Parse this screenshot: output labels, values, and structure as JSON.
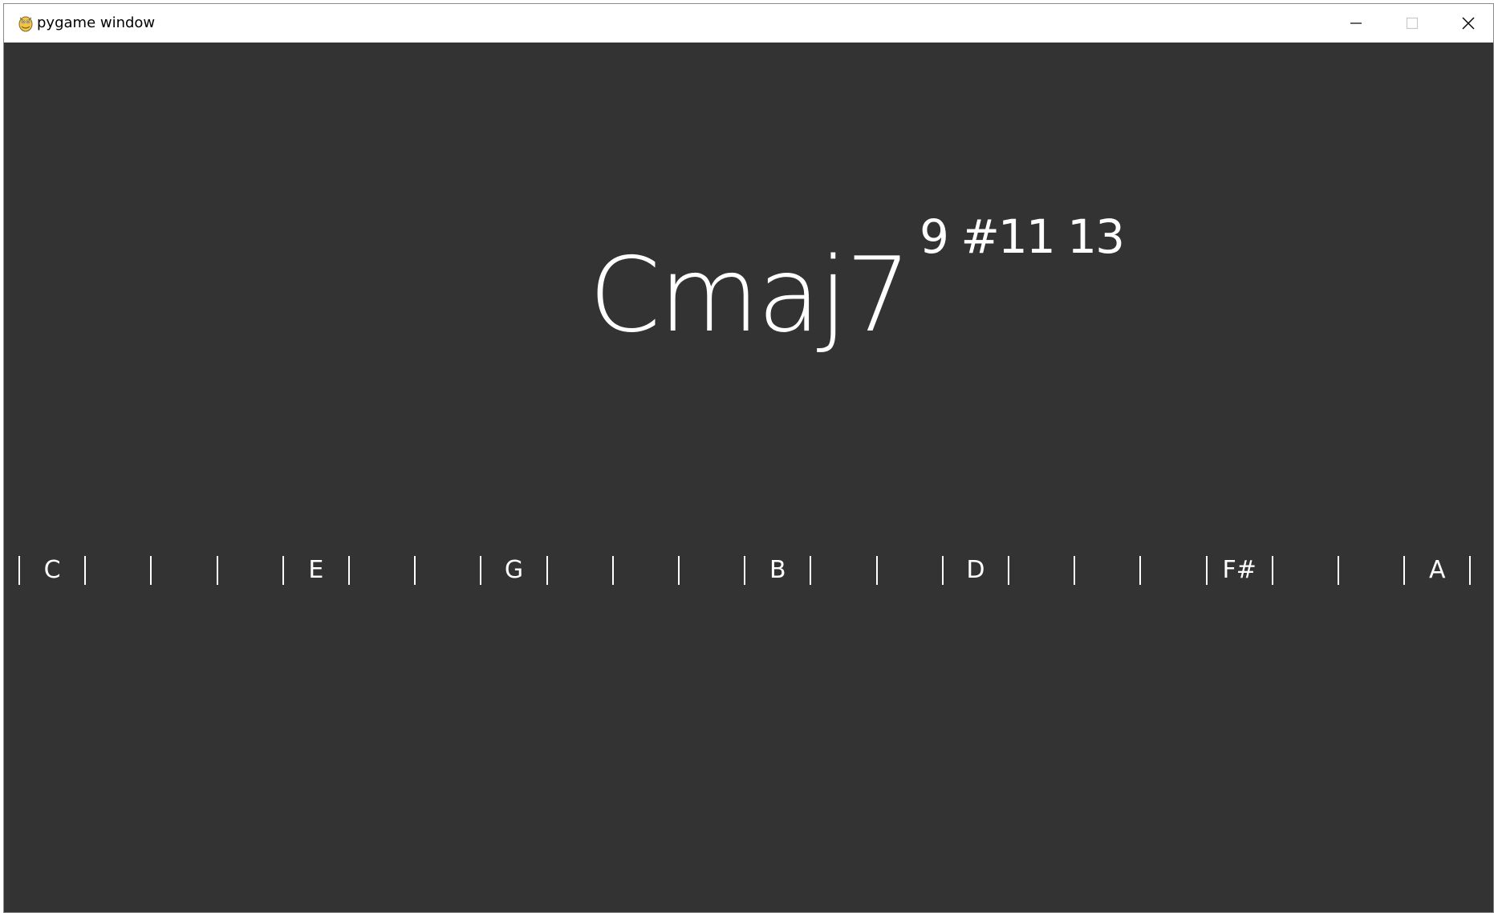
{
  "window": {
    "title": "pygame window",
    "icon": "pygame-snake-icon",
    "controls": {
      "minimize_icon": "minimize-icon",
      "maximize_icon": "maximize-icon",
      "close_icon": "close-icon"
    }
  },
  "chord": {
    "name": "Cmaj7",
    "extensions": "9 #11 13"
  },
  "note_strip": {
    "cells": [
      {
        "label": "C"
      },
      {
        "label": ""
      },
      {
        "label": ""
      },
      {
        "label": ""
      },
      {
        "label": "E"
      },
      {
        "label": ""
      },
      {
        "label": ""
      },
      {
        "label": "G"
      },
      {
        "label": ""
      },
      {
        "label": ""
      },
      {
        "label": ""
      },
      {
        "label": "B"
      },
      {
        "label": ""
      },
      {
        "label": ""
      },
      {
        "label": "D"
      },
      {
        "label": ""
      },
      {
        "label": ""
      },
      {
        "label": ""
      },
      {
        "label": "F#"
      },
      {
        "label": ""
      },
      {
        "label": ""
      },
      {
        "label": "A"
      }
    ]
  },
  "colors": {
    "background": "#333333",
    "foreground": "#ffffff",
    "titlebar": "#ffffff"
  }
}
